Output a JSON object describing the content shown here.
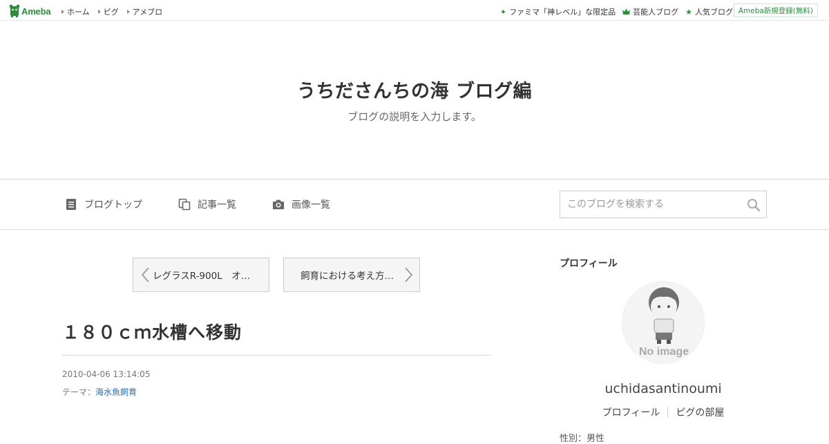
{
  "topbar": {
    "logo_text": "Ameba",
    "links": [
      {
        "label": "ホーム"
      },
      {
        "label": "ピグ"
      },
      {
        "label": "アメブロ"
      }
    ],
    "right_links": [
      {
        "label": "ファミマ「神レベル」な限定品",
        "icon": "sparkle-icon"
      },
      {
        "label": "芸能人ブログ",
        "icon": "crown-icon"
      },
      {
        "label": "人気ブログ",
        "icon": "star-icon"
      }
    ],
    "register_label": "Ameba新規登録(無料)",
    "accent_color": "#2d8c3c"
  },
  "header": {
    "title": "うちださんちの海 ブログ編",
    "description": "ブログの説明を入力します。"
  },
  "nav": {
    "items": [
      {
        "label": "ブログトップ",
        "icon": "document-icon"
      },
      {
        "label": "記事一覧",
        "icon": "copy-icon"
      },
      {
        "label": "画像一覧",
        "icon": "camera-icon"
      }
    ],
    "search": {
      "placeholder": "このブログを検索する"
    }
  },
  "pager": {
    "prev_label": "レグラスR-900L　オ…",
    "next_label": "飼育における考え方…"
  },
  "article": {
    "title": "１８０ｃｍ水槽へ移動",
    "date": "2010-04-06 13:14:05",
    "theme_prefix": "テーマ：",
    "theme_link": "海水魚飼育",
    "link_color": "#2a6db0"
  },
  "sidebar": {
    "heading": "プロフィール",
    "avatar_text": "No image",
    "username": "uchidasantinoumi",
    "links": [
      {
        "label": "プロフィール"
      },
      {
        "label": "ピグの部屋"
      }
    ],
    "partial_text": "性別：男性"
  }
}
